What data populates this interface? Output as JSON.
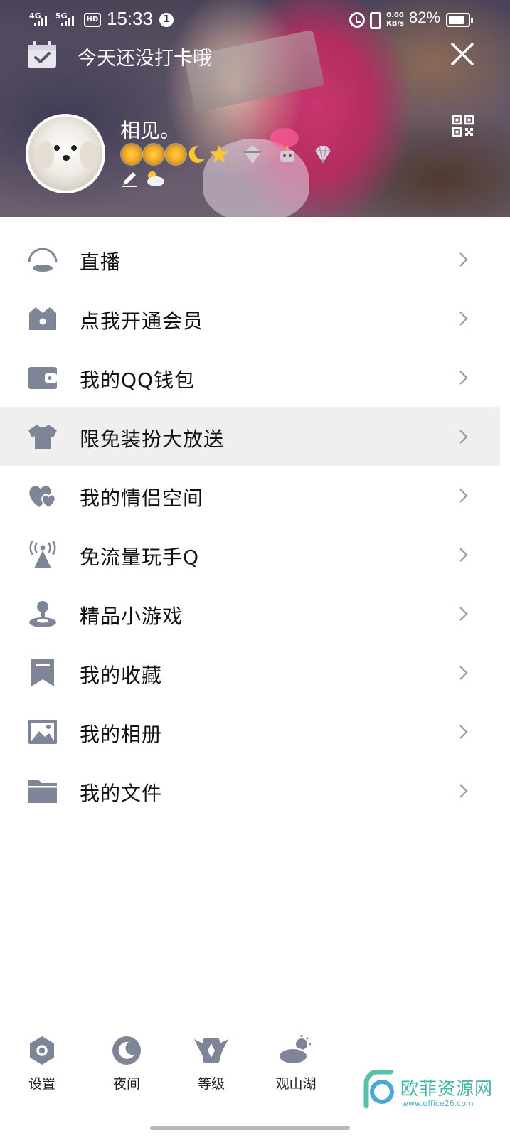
{
  "status_bar": {
    "signal1": "4G",
    "signal2": "5G",
    "hd": "HD",
    "time": "15:33",
    "notification_count": "1",
    "net_speed_value": "0.00",
    "net_speed_unit": "KB/s",
    "battery_percent": "82%",
    "battery_level": 0.82
  },
  "header": {
    "checkin_text": "今天还没打卡哦",
    "nickname": "相见。",
    "level_icons": [
      "sun-icon",
      "sun-icon",
      "sun-icon",
      "moon-icon",
      "star-icon"
    ],
    "badges": [
      "vip-badge-icon",
      "robot-badge-icon",
      "diamond-badge-icon"
    ]
  },
  "menu": {
    "items": [
      {
        "label": "直播",
        "icon": "live-icon"
      },
      {
        "label": "点我开通会员",
        "icon": "vip-crown-icon"
      },
      {
        "label": "我的QQ钱包",
        "icon": "wallet-icon"
      },
      {
        "label": "限免装扮大放送",
        "icon": "shirt-icon",
        "highlighted": true
      },
      {
        "label": "我的情侣空间",
        "icon": "couple-hearts-icon"
      },
      {
        "label": "免流量玩手Q",
        "icon": "signal-tower-icon"
      },
      {
        "label": "精品小游戏",
        "icon": "game-icon"
      },
      {
        "label": "我的收藏",
        "icon": "bookmark-icon"
      },
      {
        "label": "我的相册",
        "icon": "photo-album-icon"
      },
      {
        "label": "我的文件",
        "icon": "folder-icon"
      }
    ]
  },
  "bottom_bar": {
    "settings_label": "设置",
    "night_label": "夜间",
    "level_label": "等级",
    "weather_label": "观山湖"
  },
  "watermark": {
    "name": "欧菲资源网",
    "url": "www.office26.com"
  },
  "colors": {
    "icon_gray": "#7e8597",
    "highlight_row": "#efefef",
    "watermark_green": "#47b5a3"
  }
}
